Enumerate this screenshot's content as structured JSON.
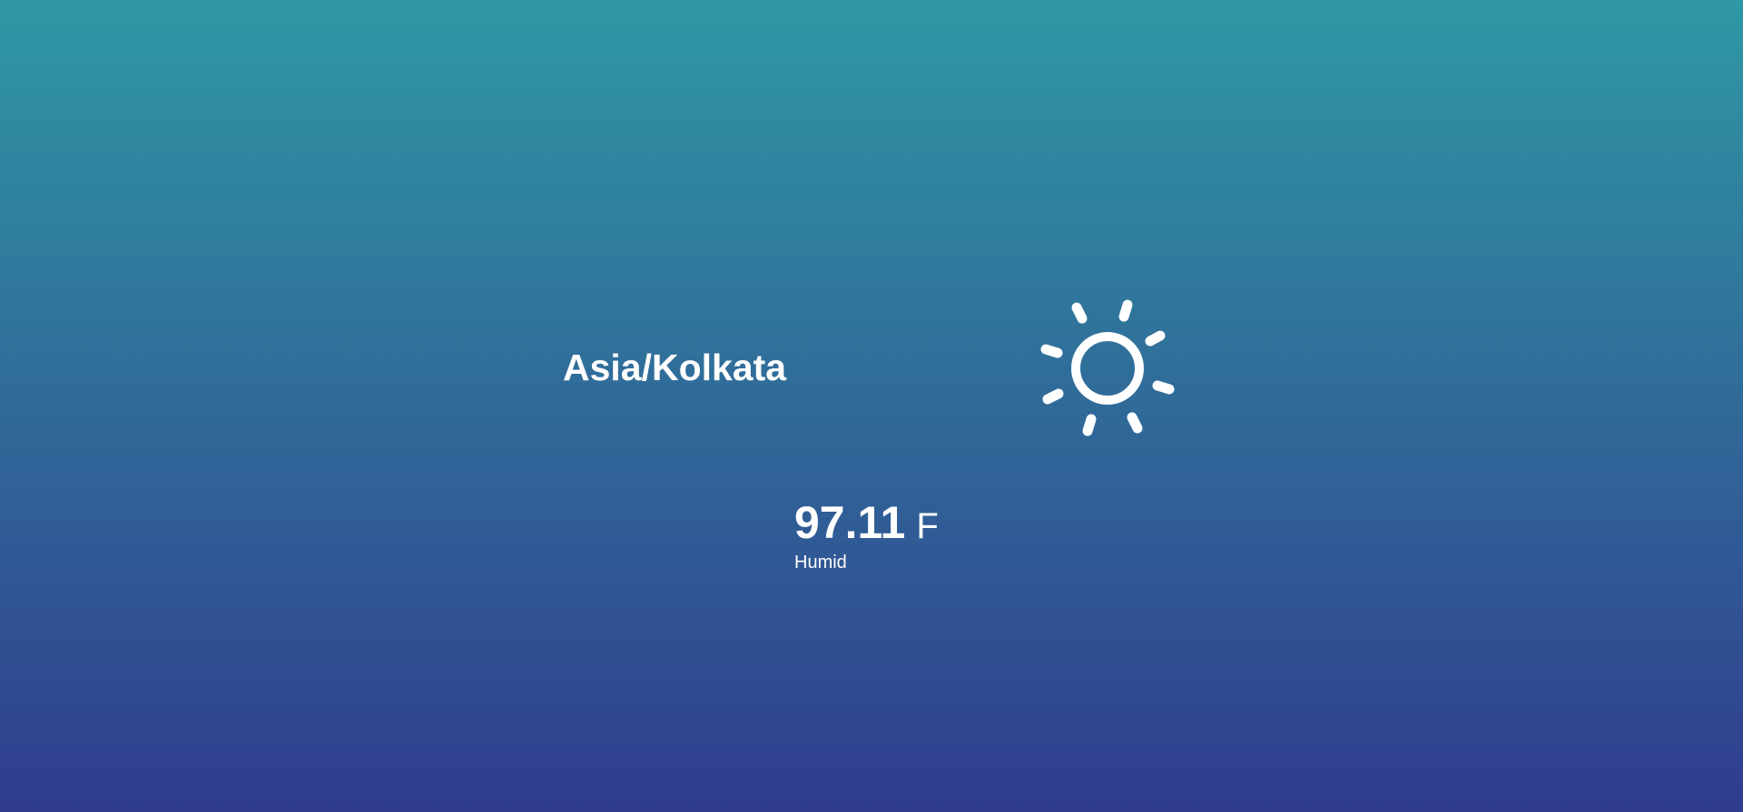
{
  "background": {
    "gradient_top": "#2f98a4",
    "gradient_bottom": "#303c8e"
  },
  "weather": {
    "location": "Asia/Kolkata",
    "temperature": "97.11",
    "unit": "F",
    "condition": "Humid",
    "icon": "sun-icon"
  }
}
